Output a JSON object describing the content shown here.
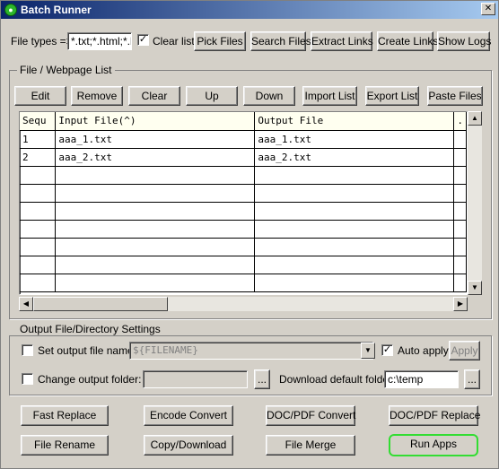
{
  "window": {
    "title": "Batch Runner",
    "close_glyph": "✕",
    "app_icon": "green-circle-icon"
  },
  "toolbar": {
    "file_types_label": "File types =>",
    "file_types_value": "*.txt;*.html;*.ht",
    "clear_list_label": "Clear list",
    "clear_list_checked": true,
    "buttons": [
      "Pick Files",
      "Search Files",
      "Extract Links",
      "Create Links",
      "Show Logs"
    ]
  },
  "file_list": {
    "group_title": "File / Webpage List",
    "buttons": [
      "Edit",
      "Remove",
      "Clear",
      "Up",
      "Down",
      "Import List",
      "Export List",
      "Paste Files"
    ],
    "columns": [
      "Sequ",
      "Input File(^)",
      "Output File",
      "."
    ],
    "rows": [
      [
        "1",
        "aaa_1.txt",
        "aaa_1.txt"
      ],
      [
        "2",
        "aaa_2.txt",
        "aaa_2.txt"
      ]
    ]
  },
  "output_settings": {
    "group_title": "Output File/Directory Settings",
    "set_output_name_label": "Set output file name:",
    "set_output_name_checked": false,
    "output_name_value": "${FILENAME}",
    "auto_apply_label": "Auto apply",
    "auto_apply_checked": true,
    "apply_label": "Apply",
    "change_folder_label": "Change output folder:",
    "change_folder_checked": false,
    "change_folder_value": "",
    "browse_label": "...",
    "download_folder_label": "Download default folder:",
    "download_folder_value": "c:\\temp",
    "download_browse_label": "..."
  },
  "actions": {
    "row1": [
      "Fast Replace",
      "Encode Convert",
      "DOC/PDF Convert",
      "DOC/PDF Replace"
    ],
    "row2": [
      "File Rename",
      "Copy/Download",
      "File Merge",
      "Run Apps"
    ]
  }
}
